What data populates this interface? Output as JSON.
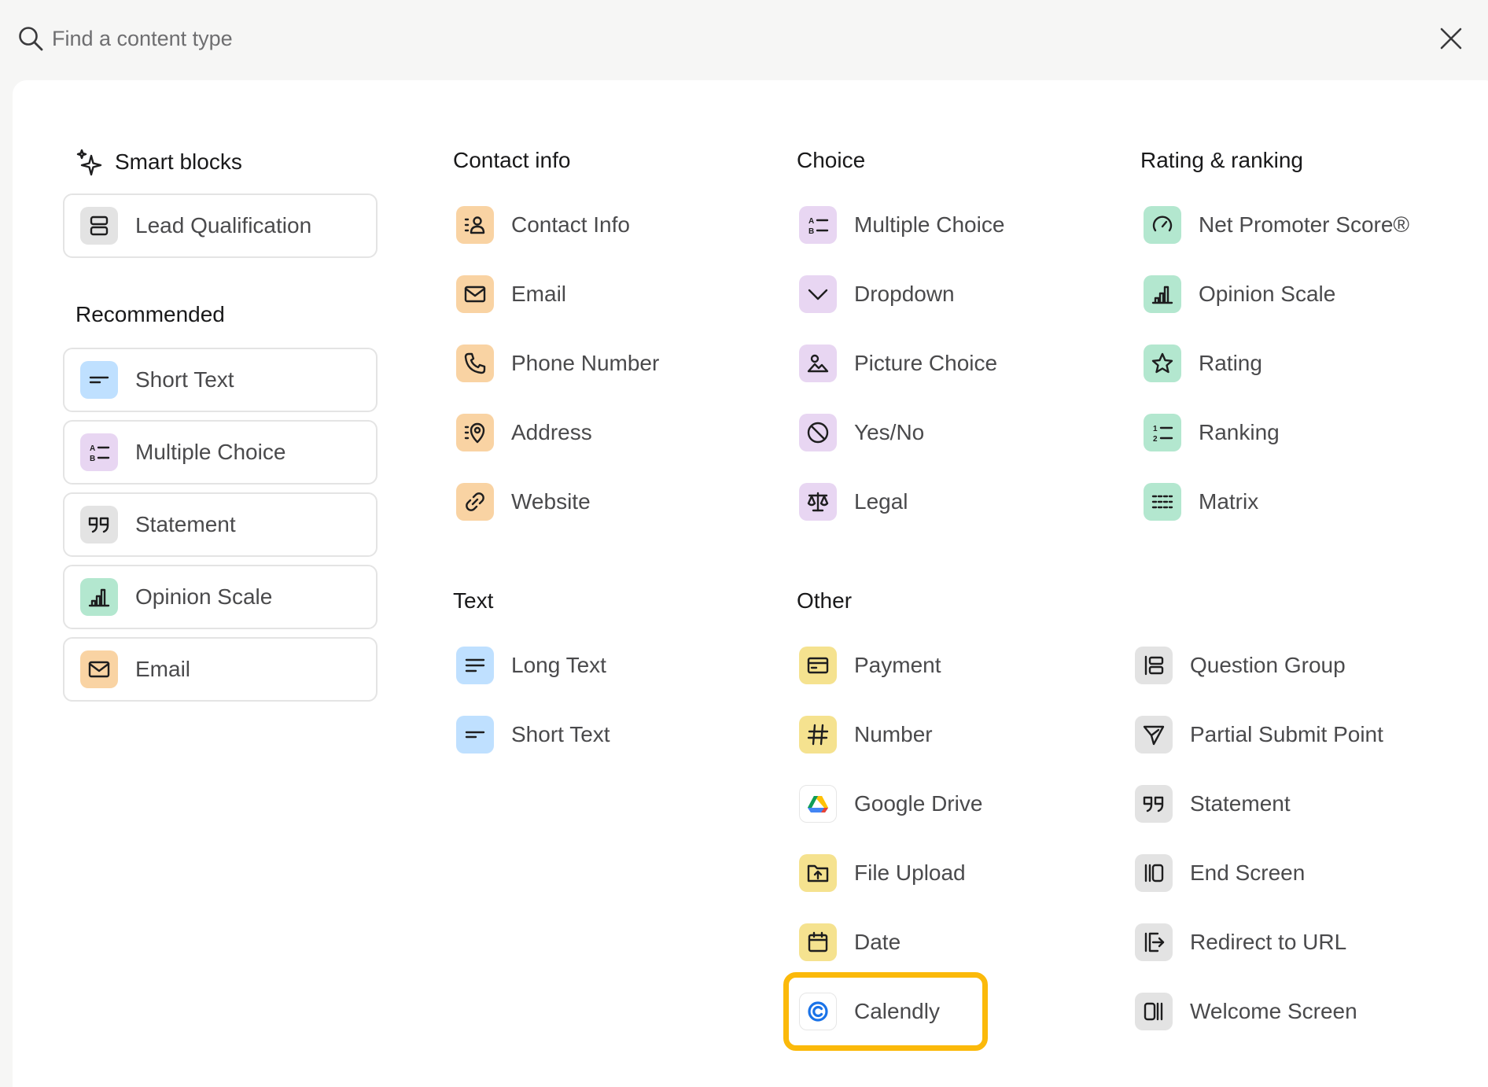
{
  "search": {
    "placeholder": "Find a content type"
  },
  "sections": {
    "smart_blocks": {
      "title": "Smart blocks",
      "items": [
        "Lead Qualification"
      ]
    },
    "recommended": {
      "title": "Recommended",
      "items": [
        "Short Text",
        "Multiple Choice",
        "Statement",
        "Opinion Scale",
        "Email"
      ]
    },
    "contact_info": {
      "title": "Contact info",
      "items": [
        "Contact Info",
        "Email",
        "Phone Number",
        "Address",
        "Website"
      ]
    },
    "choice": {
      "title": "Choice",
      "items": [
        "Multiple Choice",
        "Dropdown",
        "Picture Choice",
        "Yes/No",
        "Legal"
      ]
    },
    "rating": {
      "title": "Rating & ranking",
      "items": [
        "Net Promoter Score®",
        "Opinion Scale",
        "Rating",
        "Ranking",
        "Matrix"
      ]
    },
    "text": {
      "title": "Text",
      "items": [
        "Long Text",
        "Short Text"
      ]
    },
    "other": {
      "title": "Other",
      "items": [
        "Payment",
        "Number",
        "Google Drive",
        "File Upload",
        "Date",
        "Calendly"
      ],
      "items2": [
        "Question Group",
        "Partial Submit Point",
        "Statement",
        "End Screen",
        "Redirect to URL",
        "Welcome Screen"
      ]
    }
  },
  "colors": {
    "gray": "#e3e3e3",
    "blue": "#bfe0ff",
    "purple": "#e8d6f2",
    "green": "#b3e7cf",
    "orange": "#f9d3a3",
    "yellow": "#f5e28f",
    "highlight": "#fbb90a"
  }
}
